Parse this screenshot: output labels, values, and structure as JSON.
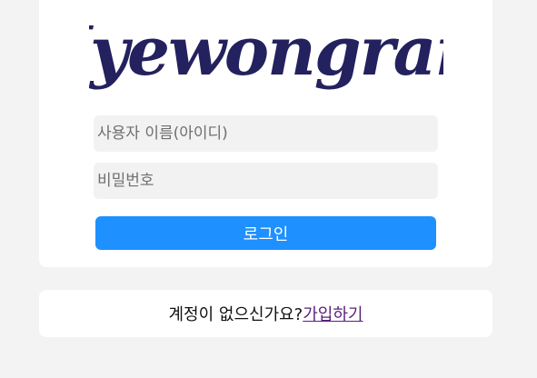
{
  "logo": {
    "text": "Hyewongram",
    "color": "#23215e"
  },
  "form": {
    "username_placeholder": "사용자 이름(아이디)",
    "password_placeholder": "비밀번호",
    "login_label": "로그인"
  },
  "signup": {
    "prompt": "계정이 없으신가요?",
    "link_label": "가입하기"
  },
  "colors": {
    "background": "#f3f3f3",
    "card": "#ffffff",
    "input_bg": "#f2f2f2",
    "button": "#1e90ff",
    "link": "#5a1f7a"
  }
}
